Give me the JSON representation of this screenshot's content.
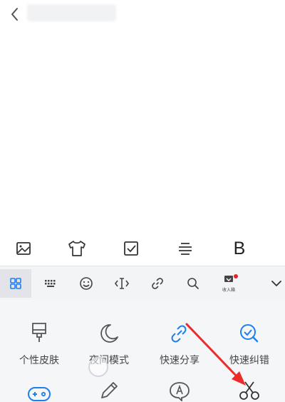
{
  "title_bar": {
    "back_icon": "chevron-left-icon"
  },
  "format_toolbar": {
    "items": [
      {
        "name": "image",
        "icon": "image-icon"
      },
      {
        "name": "theme",
        "icon": "tshirt-icon"
      },
      {
        "name": "checklist",
        "icon": "checkbox-icon"
      },
      {
        "name": "align",
        "icon": "align-center-icon"
      },
      {
        "name": "bold",
        "label": "B"
      }
    ]
  },
  "keyboard_toolbar": {
    "items": [
      {
        "name": "apps",
        "icon": "grid-icon",
        "active": true
      },
      {
        "name": "keyboard",
        "icon": "keyboard-icon"
      },
      {
        "name": "emoji",
        "icon": "smile-icon"
      },
      {
        "name": "cursor",
        "icon": "cursor-move-icon"
      },
      {
        "name": "link",
        "icon": "link-icon"
      },
      {
        "name": "search",
        "icon": "search-icon"
      },
      {
        "name": "clipboard",
        "icon": "clipboard-icon",
        "tiny_label": "收入箱",
        "badge": true
      },
      {
        "name": "collapse",
        "icon": "chevron-down-icon"
      }
    ],
    "accent": "#1e7ff0",
    "badge_color": "#e5212a"
  },
  "feature_panel": {
    "items": [
      {
        "label": "个性皮肤",
        "icon": "brush-icon"
      },
      {
        "label": "夜间模式",
        "icon": "moon-icon"
      },
      {
        "label": "快速分享",
        "icon": "share-link-icon"
      },
      {
        "label": "快速纠错",
        "icon": "check-search-icon"
      },
      {
        "label": "",
        "icon": "gamepad-icon"
      },
      {
        "label": "",
        "icon": "pencil-icon"
      },
      {
        "label": "",
        "icon": "speech-bubble-icon"
      },
      {
        "label": "",
        "icon": "scissors-icon"
      }
    ]
  },
  "colors": {
    "accent": "#1e7ff0",
    "arrow": "#ec2b2b",
    "icon_gray": "#666666"
  }
}
